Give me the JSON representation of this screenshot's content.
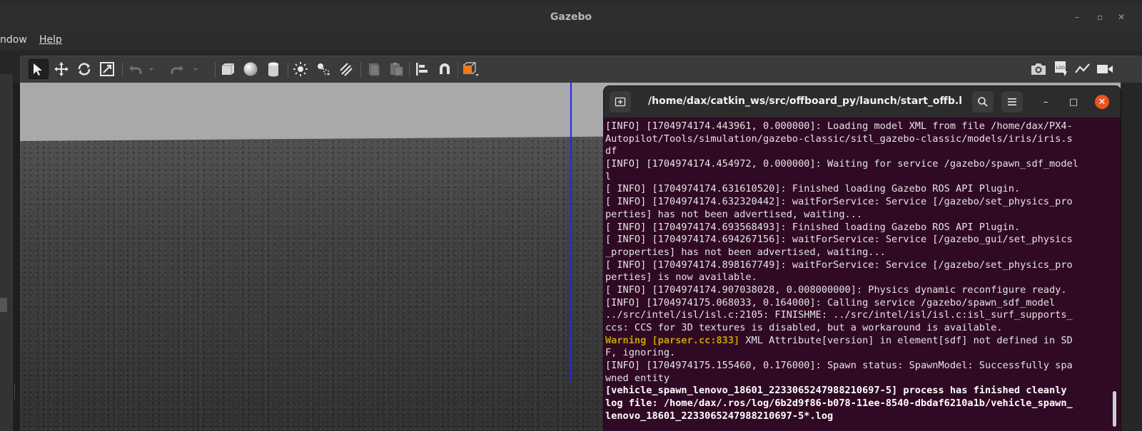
{
  "window": {
    "title": "Gazebo",
    "controls": [
      "minimize-icon",
      "maximize-icon",
      "close-icon"
    ]
  },
  "menubar": {
    "items": [
      {
        "label": "ndow"
      },
      {
        "label": "Help"
      }
    ]
  },
  "toolbar": {
    "left_tools": [
      "select-arrow-icon",
      "translate-icon",
      "rotate-icon",
      "scale-icon",
      "undo-icon",
      "undo-dropdown-icon",
      "redo-icon",
      "redo-dropdown-icon",
      "box-icon",
      "sphere-icon",
      "cylinder-icon",
      "point-light-icon",
      "spot-light-icon",
      "directional-light-icon",
      "copy-icon",
      "paste-icon",
      "align-icon",
      "snap-magnet-icon",
      "view-angle-cube-icon"
    ],
    "right_tools": [
      "screenshot-camera-icon",
      "log-icon",
      "plot-icon",
      "video-record-icon"
    ],
    "log_label": "LOG"
  },
  "terminal": {
    "title": "/home/dax/catkin_ws/src/offboard_py/launch/start_offb.lau...",
    "accent_color": "#e95420",
    "background_color": "#300a24",
    "warning_color": "#c4a000",
    "lines": [
      {
        "text": "[INFO] [1704974174.443961, 0.000000]: Loading model XML from file /home/dax/PX4-",
        "style": "normal"
      },
      {
        "text": "Autopilot/Tools/simulation/gazebo-classic/sitl_gazebo-classic/models/iris/iris.s",
        "style": "normal"
      },
      {
        "text": "df",
        "style": "normal"
      },
      {
        "text": "[INFO] [1704974174.454972, 0.000000]: Waiting for service /gazebo/spawn_sdf_model",
        "style": "normal"
      },
      {
        "text": "l",
        "style": "normal"
      },
      {
        "text": "[ INFO] [1704974174.631610520]: Finished loading Gazebo ROS API Plugin.",
        "style": "normal"
      },
      {
        "text": "[ INFO] [1704974174.632320442]: waitForService: Service [/gazebo/set_physics_pro",
        "style": "normal"
      },
      {
        "text": "perties] has not been advertised, waiting...",
        "style": "normal"
      },
      {
        "text": "[ INFO] [1704974174.693568493]: Finished loading Gazebo ROS API Plugin.",
        "style": "normal"
      },
      {
        "text": "[ INFO] [1704974174.694267156]: waitForService: Service [/gazebo_gui/set_physics",
        "style": "normal"
      },
      {
        "text": "_properties] has not been advertised, waiting...",
        "style": "normal"
      },
      {
        "text": "[ INFO] [1704974174.898167749]: waitForService: Service [/gazebo/set_physics_pro",
        "style": "normal"
      },
      {
        "text": "perties] is now available.",
        "style": "normal"
      },
      {
        "text": "[ INFO] [1704974174.907038028, 0.008000000]: Physics dynamic reconfigure ready.",
        "style": "normal"
      },
      {
        "text": "[INFO] [1704974175.068033, 0.164000]: Calling service /gazebo/spawn_sdf_model",
        "style": "normal"
      },
      {
        "text": "../src/intel/isl/isl.c:2105: FINISHME: ../src/intel/isl/isl.c:isl_surf_supports_",
        "style": "normal"
      },
      {
        "text": "ccs: CCS for 3D textures is disabled, but a workaround is available.",
        "style": "normal"
      },
      {
        "text": "XML Attribute[version] in element[sdf] not defined in SD",
        "style": "warning",
        "prefix": "Warning [parser.cc:833] "
      },
      {
        "text": "F, ignoring.",
        "style": "normal"
      },
      {
        "text": "[INFO] [1704974175.155460, 0.176000]: Spawn status: SpawnModel: Successfully spa",
        "style": "normal"
      },
      {
        "text": "wned entity",
        "style": "normal"
      },
      {
        "text": "[vehicle_spawn_lenovo_18601_2233065247988210697-5] process has finished cleanly",
        "style": "bold"
      },
      {
        "text": "log file: /home/dax/.ros/log/6b2d9f86-b078-11ee-8540-dbdaf6210a1b/vehicle_spawn_",
        "style": "bold"
      },
      {
        "text": "lenovo_18601_2233065247988210697-5*.log",
        "style": "bold"
      }
    ]
  }
}
